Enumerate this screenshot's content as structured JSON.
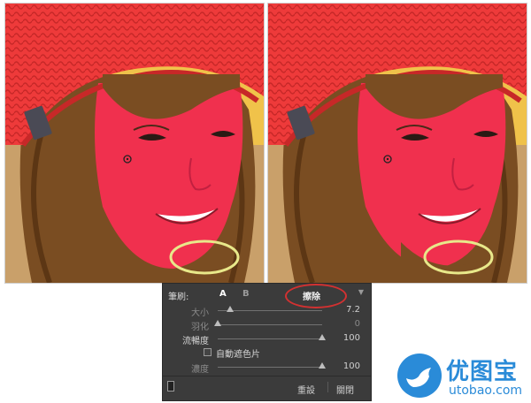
{
  "panel": {
    "brush_label": "筆刷:",
    "tab_a": "A",
    "tab_b": "B",
    "erase_label": "擦除",
    "size": {
      "label": "大小",
      "value": "7.2",
      "fraction": 0.12
    },
    "feather": {
      "label": "羽化",
      "value": "0",
      "fraction": 0.0
    },
    "flow": {
      "label": "流暢度",
      "value": "100",
      "fraction": 1.0
    },
    "auto_mask": {
      "label": "自動遮色片",
      "checked": false
    },
    "density": {
      "label": "濃度",
      "value": "100",
      "fraction": 1.0
    },
    "reset_label": "重設",
    "close_label": "關閉",
    "highlight_color": "#d23131"
  },
  "photos": {
    "mask_color": "#f0304e",
    "annotation_color": "#e8e88a"
  },
  "watermark": {
    "name": "优图宝",
    "url": "utobao.com",
    "color": "#2a8bd8"
  }
}
